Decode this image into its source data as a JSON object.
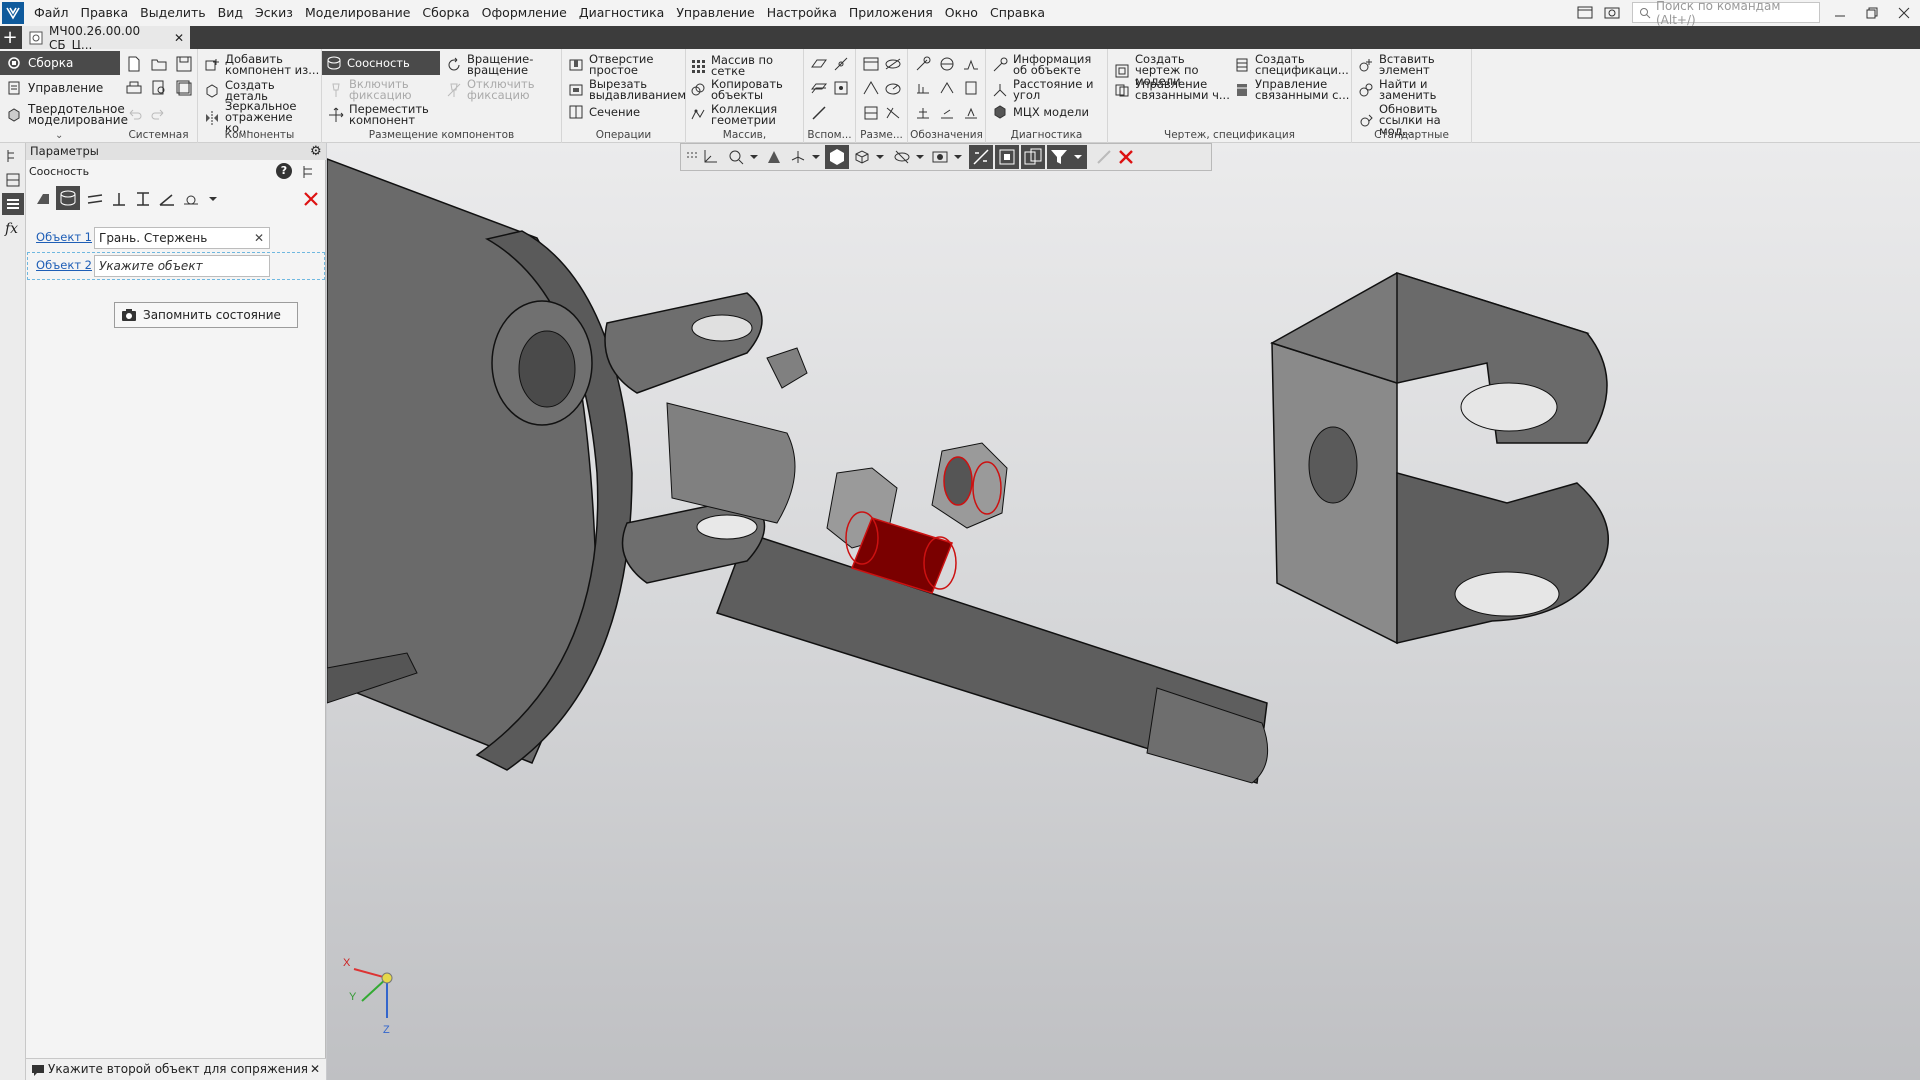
{
  "menu": [
    "Файл",
    "Правка",
    "Выделить",
    "Вид",
    "Эскиз",
    "Моделирование",
    "Сборка",
    "Оформление",
    "Диагностика",
    "Управление",
    "Настройка",
    "Приложения",
    "Окно",
    "Справка"
  ],
  "search": {
    "placeholder": "Поиск по командам (Alt+/)"
  },
  "document_tab": {
    "title": "МЧ00.26.00.00 СБ_Ц..."
  },
  "ribbon": {
    "modes": [
      "Сборка",
      "Управление",
      "Твердотельное моделирование"
    ],
    "groups": {
      "system": "Системная",
      "components": "Компоненты",
      "placement": "Размещение компонентов",
      "operations": "Операции",
      "array": "Массив, копирование",
      "aux": "Вспом...",
      "dims": "Разме...",
      "notation": "Обозначения",
      "diagnostics": "Диагностика",
      "drawing": "Чертеж, спецификация",
      "standard": "Стандартные изделия"
    },
    "buttons": {
      "add_component": "Добавить компонент из...",
      "create_part": "Создать деталь",
      "mirror": "Зеркальное отражение ко...",
      "coaxial": "Соосность",
      "enable_fix": "Включить фиксацию",
      "move_component": "Переместить компонент",
      "rotate": "Вращение-вращение",
      "disable_fix": "Отключить фиксацию",
      "hole": "Отверстие простое",
      "cut_extrude": "Вырезать выдавливанием",
      "section": "Сечение",
      "grid_array": "Массив по сетке",
      "copy_objects": "Копировать объекты",
      "geometry_collection": "Коллекция геометрии",
      "object_info": "Информация об объекте",
      "distance_angle": "Расстояние и угол",
      "mass_props": "МЦХ модели",
      "create_drawing": "Создать чертеж по модели",
      "manage_linked_1": "Управление связанными ч...",
      "create_spec": "Создать спецификаци...",
      "manage_linked_2": "Управление связанными с...",
      "insert_element": "Вставить элемент",
      "find_replace": "Найти и заменить",
      "update_links": "Обновить ссылки на мод..."
    }
  },
  "panel": {
    "title": "Параметры",
    "command": "Соосность",
    "object1_label": "Объект 1",
    "object1_value": "Грань. Стержень",
    "object2_label": "Объект 2",
    "object2_placeholder": "Укажите объект",
    "remember_state": "Запомнить состояние"
  },
  "status": {
    "message": "Укажите второй объект для сопряжения"
  },
  "axes": {
    "x": "X",
    "y": "Y",
    "z": "Z"
  },
  "colors": {
    "accent": "#4a4a4a",
    "highlight": "#cc1111",
    "selection_part": "#7a0000",
    "model": "#6e6e6e"
  }
}
